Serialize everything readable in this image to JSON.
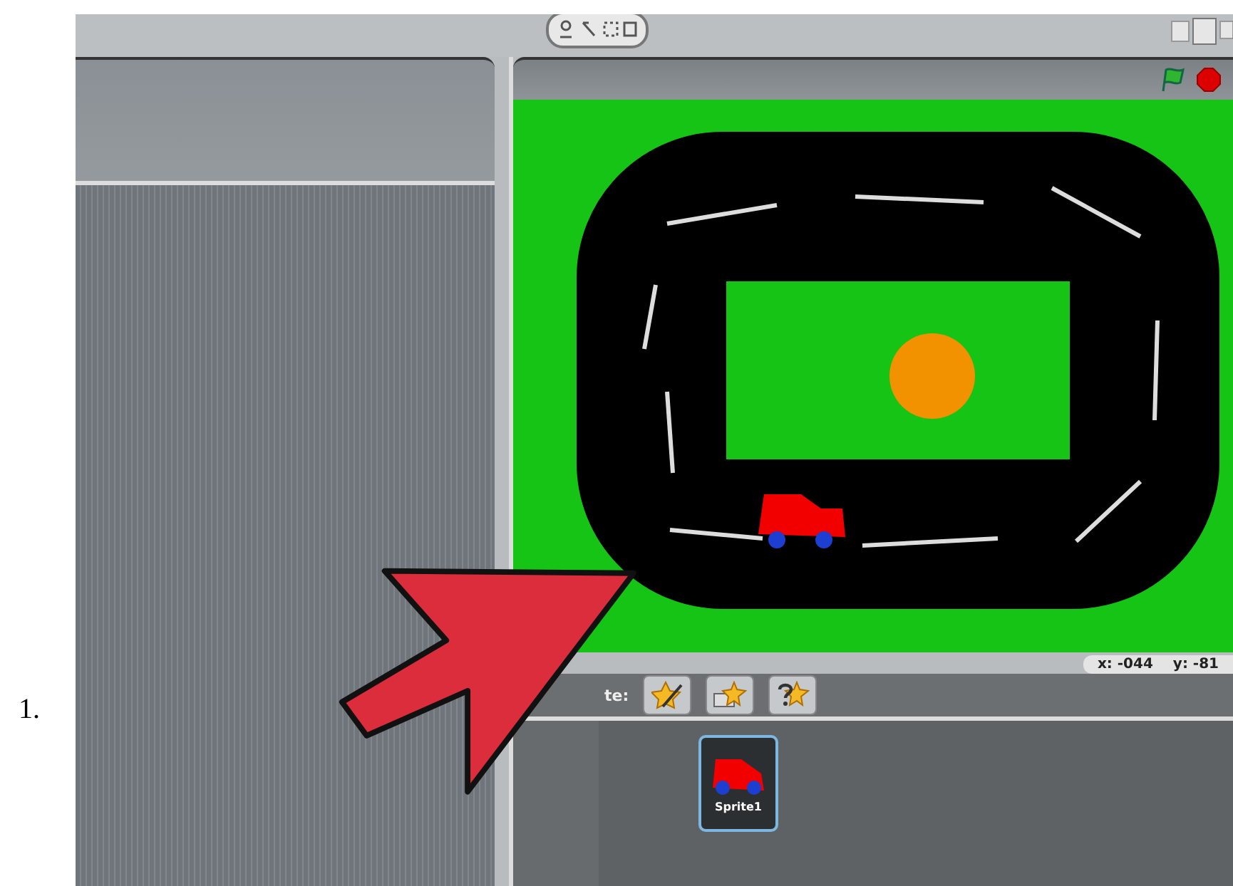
{
  "list_marker": "1.",
  "stage": {
    "x_reading": "x: -044",
    "y_reading": "y: -81"
  },
  "sprite_pane": {
    "label": "te:",
    "sprites": [
      {
        "name": "Sprite1",
        "selected": true
      }
    ]
  }
}
